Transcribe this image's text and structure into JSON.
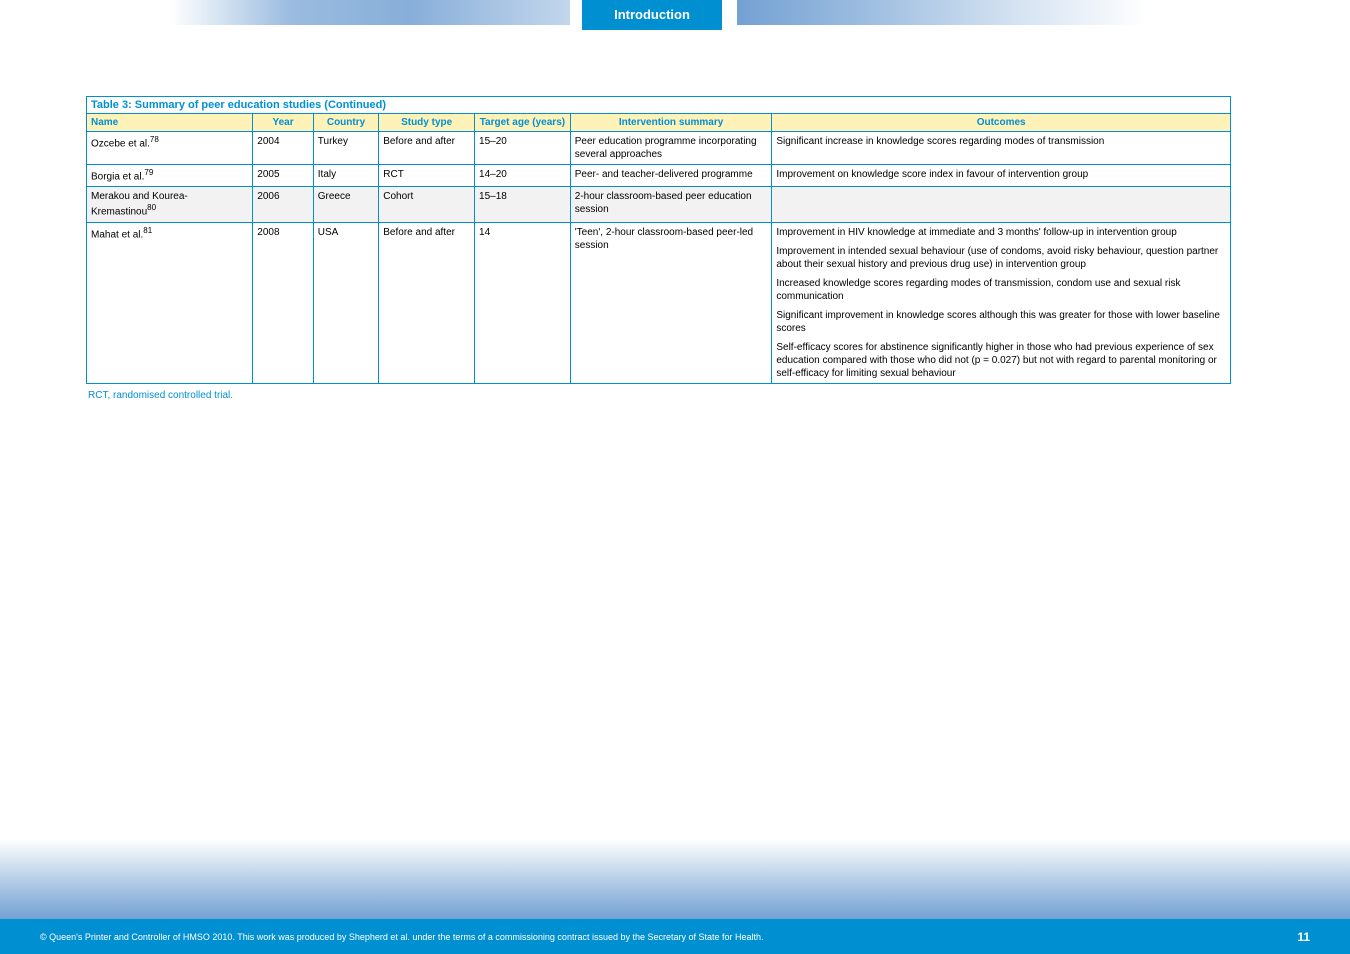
{
  "header": {
    "tab": "Introduction"
  },
  "table": {
    "title": "Table 3: Summary of peer education studies (Continued)",
    "columns": [
      "Name",
      "Year",
      "Country",
      "Study type",
      "Target age (years)",
      "Intervention summary",
      "Outcomes"
    ],
    "rows": [
      {
        "name": "Ozcebe et al.",
        "sup": "78",
        "year": "2004",
        "country": "Turkey",
        "type": "Before and after",
        "age": "15–20",
        "intervention": "Peer education programme incorporating several approaches",
        "outcomes": "Significant increase in knowledge scores regarding modes of transmission",
        "gray": false
      },
      {
        "name": "Borgia et al.",
        "sup": "79",
        "year": "2005",
        "country": "Italy",
        "type": "RCT",
        "age": "14–20",
        "intervention": "Peer- and teacher-delivered programme",
        "outcomes": "Improvement on knowledge score index in favour of intervention group",
        "gray": false
      },
      {
        "name": "Merakou and Kourea-Kremastinou",
        "sup": "80",
        "year": "2006",
        "country": "Greece",
        "type": "Cohort",
        "age": "15–18",
        "intervention": "2-hour classroom-based peer education session",
        "outcomes": "",
        "gray": true
      },
      {
        "name": "Mahat et al.",
        "sup": "81",
        "year": "2008",
        "country": "USA",
        "type": "Before and after",
        "age": "14",
        "intervention": "'Teen', 2-hour classroom-based peer-led session",
        "outcomes_list": [
          "Improvement in HIV knowledge at immediate and 3 months' follow-up in intervention group",
          "Improvement in intended sexual behaviour (use of condoms, avoid risky behaviour, question partner about their sexual history and previous drug use) in intervention group",
          "Increased knowledge scores regarding modes of transmission, condom use and sexual risk communication",
          "Significant improvement in knowledge scores although this was greater for those with lower baseline scores",
          "Self-efficacy scores for abstinence significantly higher in those who had previous experience of sex education compared with those who did not (p = 0.027) but not with regard to parental monitoring or self-efficacy for limiting sexual behaviour"
        ],
        "gray": false
      }
    ],
    "footnote": "RCT, randomised controlled trial."
  },
  "footer": {
    "left": "© Queen's Printer and Controller of HMSO 2010. This work was produced by Shepherd et al. under the terms of a commissioning contract issued by the Secretary of State for Health.",
    "right": "11"
  }
}
